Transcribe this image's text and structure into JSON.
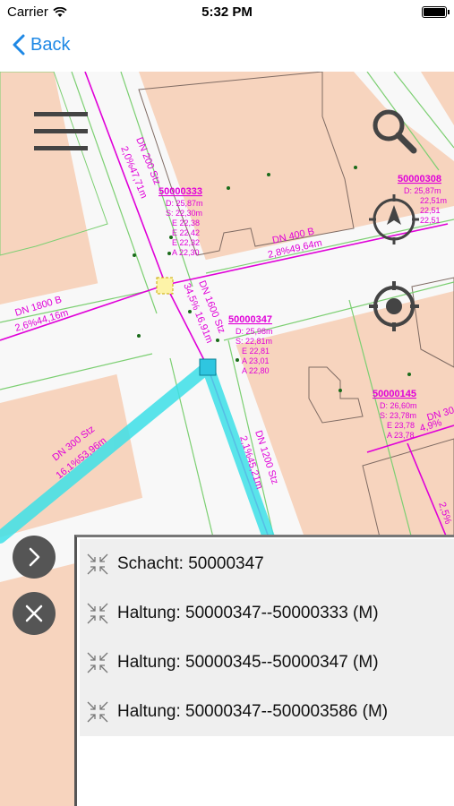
{
  "status_bar": {
    "carrier": "Carrier",
    "time": "5:32 PM"
  },
  "nav": {
    "back_label": "Back"
  },
  "map": {
    "pipe_labels": [
      {
        "id": "dn200",
        "text": "DN 200 Stz"
      },
      {
        "id": "dn200-val",
        "text": "2,0%47,71m"
      },
      {
        "id": "dn400",
        "text": "DN 400 B"
      },
      {
        "id": "dn400-val",
        "text": "2,8%49,64m"
      },
      {
        "id": "dn1800",
        "text": "DN 1800 B"
      },
      {
        "id": "dn1800-val",
        "text": "2,6%44,16m"
      },
      {
        "id": "dn1600",
        "text": "DN 1600 Stz"
      },
      {
        "id": "dn1600-val",
        "text": "34,5% 16,91m"
      },
      {
        "id": "dn300",
        "text": "DN 300 Stz"
      },
      {
        "id": "dn300-val",
        "text": "16,1%53,96m"
      },
      {
        "id": "dn1200",
        "text": "DN 1200 Stz"
      },
      {
        "id": "dn1200-val",
        "text": "2,1%45,21m"
      },
      {
        "id": "dn30",
        "text": "DN 30"
      },
      {
        "id": "dn30-val",
        "text": "4,9%"
      },
      {
        "id": "edge-val",
        "text": "2,5%"
      }
    ],
    "shafts": [
      {
        "id": "50000333",
        "lines": [
          "D: 25,87m",
          "S: 22,30m",
          "E 22,38",
          "E 22,42",
          "E 22,32",
          "A 22,30"
        ]
      },
      {
        "id": "50000308",
        "lines": [
          "D: 25,87m",
          "22,51m",
          "22,51",
          "22,51"
        ]
      },
      {
        "id": "50000347",
        "lines": [
          "D: 25,98m",
          "S: 22,81m",
          "E 22,81",
          "A 23,01",
          "A 22,80"
        ]
      },
      {
        "id": "50000145",
        "lines": [
          "D: 26,60m",
          "S: 23,78m",
          "E 23,78",
          "A 23,78"
        ]
      }
    ]
  },
  "panel": {
    "items": [
      {
        "label": "Schacht: 50000347"
      },
      {
        "label": "Haltung: 50000347--50000333 (M)"
      },
      {
        "label": "Haltung: 50000345--50000347 (M)"
      },
      {
        "label": "Haltung: 50000347--500003586 (M)"
      }
    ]
  },
  "colors": {
    "accent": "#1e88e5",
    "parcel": "#f7d4be",
    "road": "#f8f8f8",
    "pipe": "#e000d8",
    "selection": "#3de0e8",
    "boundary": "#7ccf72"
  }
}
